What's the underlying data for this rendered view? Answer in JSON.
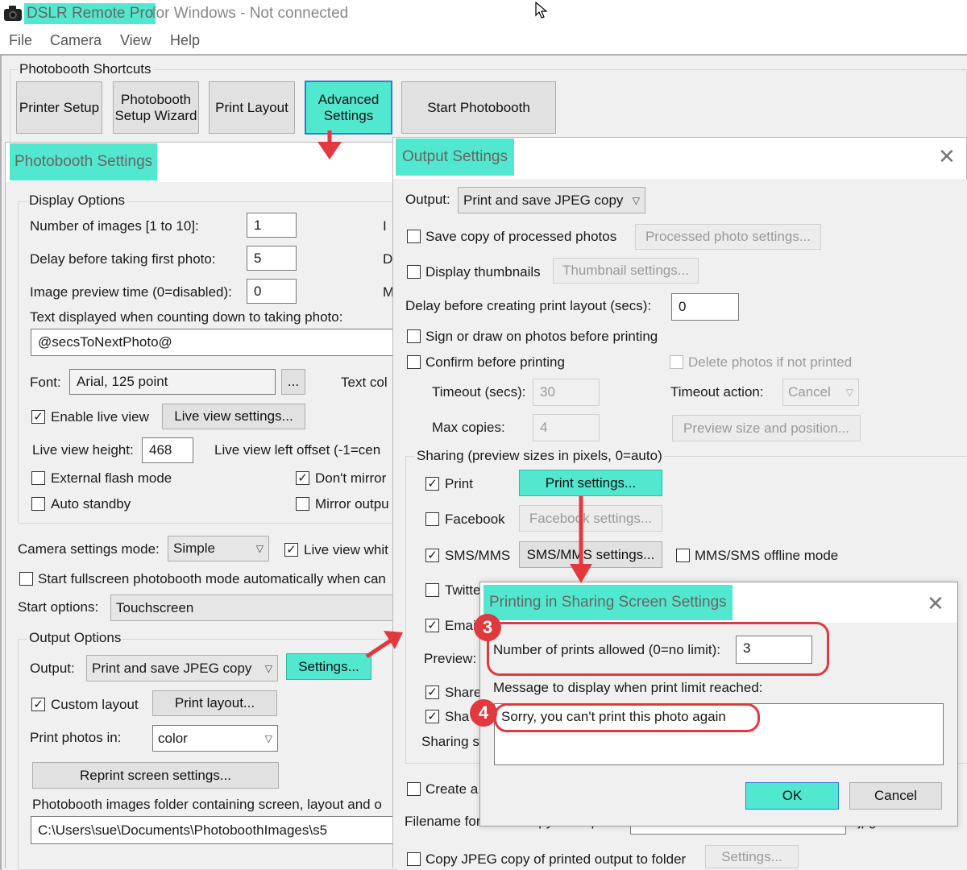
{
  "titlebar": {
    "app_name": "DSLR Remote Pro",
    "title_rest": " for Windows - Not connected"
  },
  "menu": [
    "File",
    "Camera",
    "View",
    "Help"
  ],
  "shortcuts": {
    "title": "Photobooth Shortcuts",
    "printer_setup": "Printer Setup",
    "wizard_line1": "Photobooth",
    "wizard_line2": "Setup Wizard",
    "print_layout": "Print Layout",
    "advanced_line1": "Advanced",
    "advanced_line2": "Settings",
    "start": "Start Photobooth"
  },
  "photobooth_settings": {
    "title": "Photobooth Settings",
    "display_options": "Display Options",
    "num_images_label": "Number of images [1 to 10]:",
    "num_images": "1",
    "delay_first_label": "Delay before taking first photo:",
    "delay_first": "5",
    "preview_time_label": "Image preview time (0=disabled):",
    "preview_time": "0",
    "countdown_text_label": "Text displayed when counting down to taking photo:",
    "countdown_text": "@secsToNextPhoto@",
    "font_label": "Font:",
    "font_value": "Arial, 125 point",
    "font_btn": "...",
    "text_color_label": "Text col",
    "right_clip_1": "I",
    "right_clip_2": "D",
    "right_clip_3": "M",
    "enable_live_view": "Enable live view",
    "live_view_settings": "Live view settings...",
    "live_view_height_label": "Live view height:",
    "live_view_height": "468",
    "live_view_offset_label": "Live view left offset (-1=cen",
    "external_flash": "External flash mode",
    "dont_mirror": "Don't mirror",
    "auto_standby": "Auto standby",
    "mirror_output": "Mirror outpu",
    "camera_mode_label": "Camera settings mode:",
    "camera_mode": "Simple",
    "live_view_white": "Live view whit",
    "start_fullscreen": "Start fullscreen photobooth mode automatically when can",
    "start_options_label": "Start options:",
    "start_options": "Touchscreen",
    "output_options": "Output Options",
    "output_label": "Output:",
    "output_value": "Print and save JPEG copy",
    "settings_btn": "Settings...",
    "custom_layout": "Custom layout",
    "print_layout_btn": "Print layout...",
    "print_photos_in_label": "Print photos in:",
    "print_photos_in": "color",
    "reprint_btn": "Reprint screen settings...",
    "folder_label": "Photobooth images folder containing screen, layout and o",
    "folder_path": "C:\\Users\\sue\\Documents\\PhotoboothImages\\s5"
  },
  "output_settings": {
    "title": "Output Settings",
    "close": "✕",
    "output_label": "Output:",
    "output_value": "Print and save JPEG copy",
    "save_copy": "Save copy of processed photos",
    "processed_btn": "Processed photo settings...",
    "display_thumbs": "Display thumbnails",
    "thumb_btn": "Thumbnail settings...",
    "delay_layout_label": "Delay before creating print layout (secs):",
    "delay_layout": "0",
    "sign_draw": "Sign or draw on photos before printing",
    "confirm_print": "Confirm before printing",
    "delete_not_printed": "Delete photos if not printed",
    "timeout_label": "Timeout (secs):",
    "timeout": "30",
    "timeout_action_label": "Timeout action:",
    "timeout_action": "Cancel",
    "max_copies_label": "Max copies:",
    "max_copies": "4",
    "preview_btn": "Preview size and position...",
    "sharing_label": "Sharing (preview sizes in pixels, 0=auto)",
    "print": "Print",
    "print_settings_btn": "Print settings...",
    "facebook": "Facebook",
    "facebook_btn": "Facebook settings...",
    "sms": "SMS/MMS",
    "sms_btn": "SMS/MMS settings...",
    "sms_offline": "MMS/SMS offline mode",
    "twitter_clip": "Twitte",
    "email_clip": "Emai",
    "preview_clip": "Preview:",
    "share_clip1": "Share",
    "share_clip2": "Sha",
    "sharing_s_clip": "Sharing s",
    "create_clip": "Create a",
    "filename_clip": "Filename for JPEG copy of output:",
    "filename_ext": ".jpg",
    "copy_jpeg": "Copy JPEG copy of printed output to folder",
    "copy_settings_btn": "Settings..."
  },
  "print_sharing": {
    "title": "Printing in Sharing Screen Settings",
    "close": "✕",
    "num_prints_label": "Number of prints allowed (0=no limit):",
    "num_prints": "3",
    "message_label": "Message to display when print limit reached:",
    "message": "Sorry, you can't print this photo again",
    "ok": "OK",
    "cancel": "Cancel",
    "badge3": "3",
    "badge4": "4"
  },
  "colors": {
    "highlight": "#51e8cf",
    "annotation_red": "#e0393e"
  }
}
